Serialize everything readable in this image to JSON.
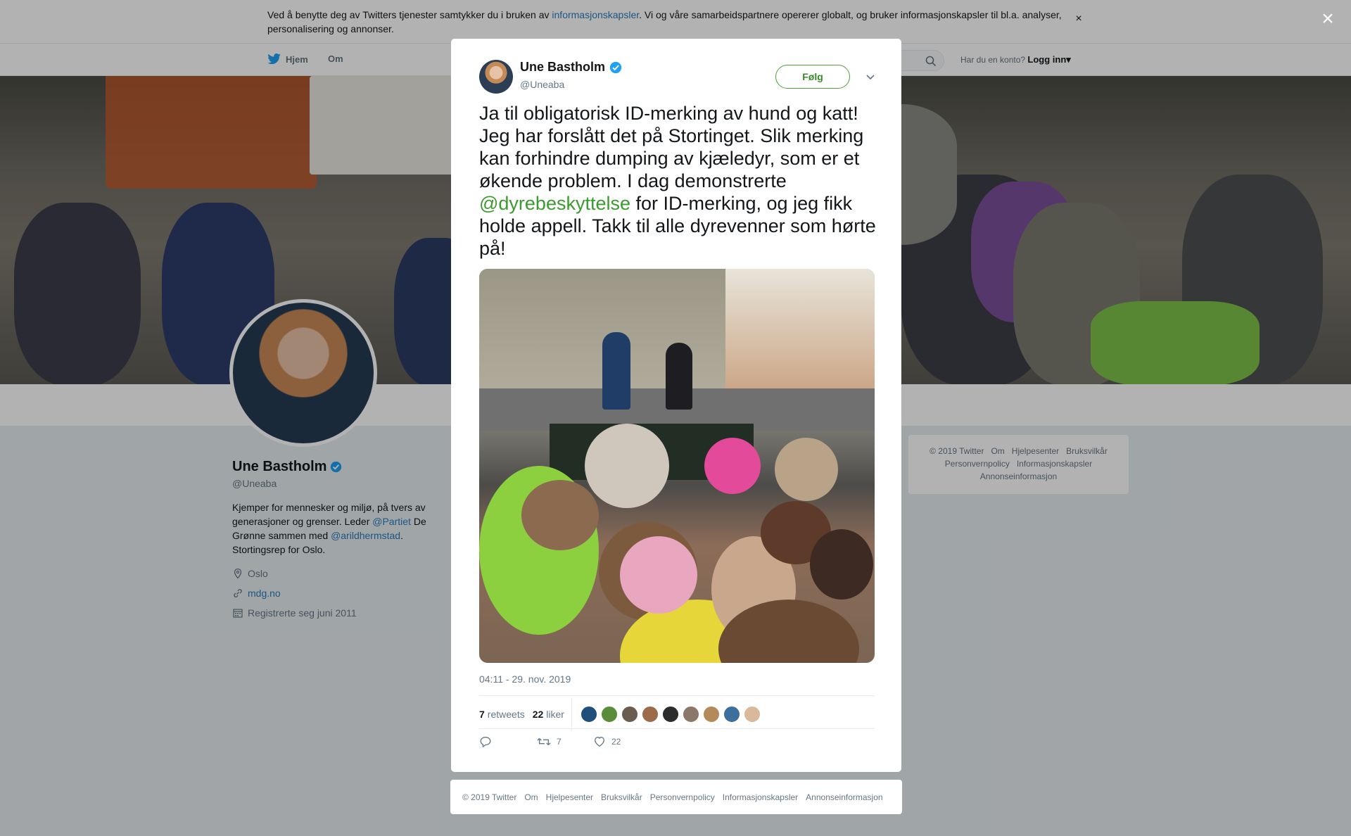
{
  "cookie_banner": {
    "text_before": "Ved å benytte deg av Twitters tjenester samtykker du i bruken av ",
    "link": "informasjonskapsler",
    "text_after": ". Vi og våre samarbeidspartnere opererer globalt, og bruker informasjonskapsler til bl.a. analyser, personalisering og annonser.",
    "close": "×"
  },
  "nav": {
    "home": "Hjem",
    "about": "Om",
    "account_prompt": "Har du en konto?",
    "login": "Logg inn"
  },
  "profile": {
    "name": "Une Bastholm",
    "handle": "@Uneaba",
    "bio_1": "Kjemper for mennesker og miljø, på tvers av generasjoner og grenser. Leder ",
    "bio_link_1": "@Partiet",
    "bio_2": " De Grønne sammen med ",
    "bio_link_2": "@arildhermstad",
    "bio_3": ". Stortingsrep for Oslo.",
    "location": "Oslo",
    "website": "mdg.no",
    "joined": "Registrerte seg juni 2011"
  },
  "side_footer": [
    "© 2019 Twitter",
    "Om",
    "Hjelpesenter",
    "Bruksvilkår",
    "Personvernpolicy",
    "Informasjonskapsler",
    "Annonseinformasjon"
  ],
  "modal": {
    "close": "×",
    "author_name": "Une Bastholm",
    "author_handle": "@Uneaba",
    "follow_label": "Følg",
    "text_1": "Ja til obligatorisk ID-merking av hund og katt! Jeg har forslått det på Stortinget. Slik merking kan forhindre dumping av kjæledyr, som er et økende problem. I dag demonstrerte ",
    "mention": "@dyrebeskyttelse",
    "text_2": " for ID-merking, og jeg fikk holde appell. Takk til alle dyrevenner som hørte på!",
    "timestamp": "04:11 - 29. nov. 2019",
    "retweets_count": "7",
    "retweets_label": "retweets",
    "likes_count": "22",
    "likes_label": "liker",
    "action_retweet_count": "7",
    "action_like_count": "22"
  },
  "modal_footer": [
    "© 2019 Twitter",
    "Om",
    "Hjelpesenter",
    "Bruksvilkår",
    "Personvernpolicy",
    "Informasjonskapsler",
    "Annonseinformasjon"
  ],
  "colors": {
    "accent_green": "#3a9b2e",
    "verified_blue": "#1da1f2",
    "link_blue": "#2b7bb9"
  }
}
